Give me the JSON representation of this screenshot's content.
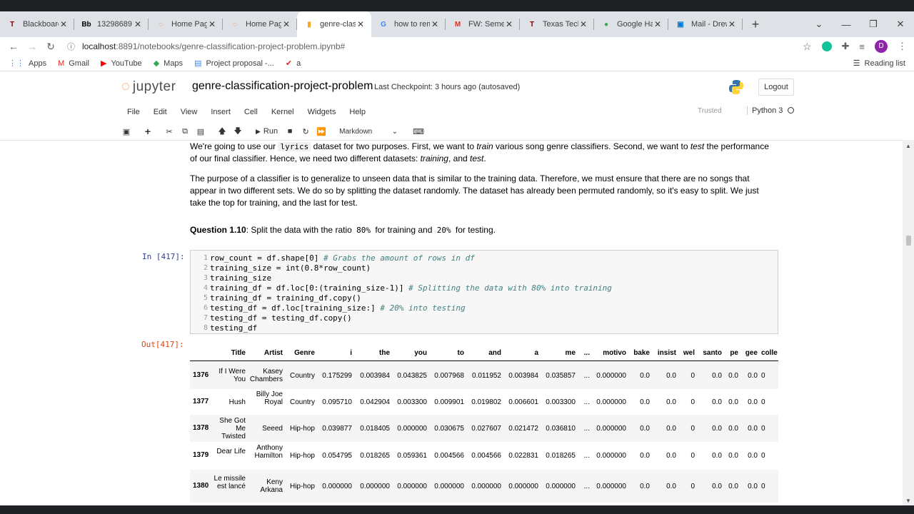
{
  "browser": {
    "tabs": [
      {
        "title": "Blackboard",
        "fav": "T",
        "color": "#8b0000"
      },
      {
        "title": "13298689",
        "fav": "Bb",
        "color": "#000000"
      },
      {
        "title": "Home Page",
        "fav": "◌",
        "color": "#f37726"
      },
      {
        "title": "Home Page",
        "fav": "◌",
        "color": "#f37726"
      },
      {
        "title": "genre-class",
        "fav": "▮",
        "color": "#f9a825"
      },
      {
        "title": "how to rem",
        "fav": "G",
        "color": "#4285f4"
      },
      {
        "title": "FW: Semest",
        "fav": "M",
        "color": "#d93025"
      },
      {
        "title": "Texas Tech",
        "fav": "T",
        "color": "#8b0000"
      },
      {
        "title": "Google Har",
        "fav": "●",
        "color": "#34a853"
      },
      {
        "title": "Mail - Drew",
        "fav": "▣",
        "color": "#0078d4"
      }
    ],
    "active_tab": 4,
    "url_host": "localhost",
    "url_rest": ":8891/notebooks/genre-classification-project-problem.ipynb#",
    "profile_letter": "D",
    "bookmarks": [
      {
        "label": "Apps",
        "icon": "apps-icon"
      },
      {
        "label": "Gmail",
        "icon": "gmail-icon"
      },
      {
        "label": "YouTube",
        "icon": "youtube-icon"
      },
      {
        "label": "Maps",
        "icon": "maps-icon"
      },
      {
        "label": "Project proposal -...",
        "icon": "docs-icon"
      },
      {
        "label": "a",
        "icon": "check-icon"
      }
    ],
    "reading_list": "Reading list"
  },
  "jupyter": {
    "logo_text": "jupyter",
    "notebook_title": "genre-classification-project-problem",
    "checkpoint": "Last Checkpoint: 3 hours ago  (autosaved)",
    "logout": "Logout",
    "menu": [
      "File",
      "Edit",
      "View",
      "Insert",
      "Cell",
      "Kernel",
      "Widgets",
      "Help"
    ],
    "trusted": "Trusted",
    "kernel": "Python 3",
    "run_label": "Run",
    "cell_type": "Markdown"
  },
  "notebook": {
    "p1_a": "We're going to use our ",
    "p1_code": "lyrics",
    "p1_b": " dataset for two purposes. First, we want to ",
    "p1_train": "train",
    "p1_c": " various song genre classifiers. Second, we want to ",
    "p1_test": "test",
    "p1_d": " the performance of our final classifier. Hence, we need two different datasets: ",
    "p1_training": "training",
    "p1_e": ", and ",
    "p1_testing": "test",
    "p1_f": ".",
    "p2": "The purpose of a classifier is to generalize to unseen data that is similar to the training data. Therefore, we must ensure that there are no songs that appear in two different sets. We do so by splitting the dataset randomly. The dataset has already been permuted randomly, so it's easy to split. We just take the top for training, and the last for test.",
    "q_label": "Question 1.10",
    "q_a": ": Split the data with the ratio ",
    "q_80": "80%",
    "q_b": " for training and ",
    "q_20": "20%",
    "q_c": " for testing.",
    "in_prompt": "In [417]:",
    "out_prompt": "Out[417]:",
    "code_lines": [
      {
        "n": "1",
        "code": "row_count = df.shape[0] ",
        "comment": "# Grabs the amount of rows in df"
      },
      {
        "n": "2",
        "code": "training_size = int(0.8*row_count)",
        "comment": ""
      },
      {
        "n": "3",
        "code": "training_size",
        "comment": ""
      },
      {
        "n": "4",
        "code": "training_df = df.loc[0:(training_size-1)] ",
        "comment": "# Splitting the data with 80% into training"
      },
      {
        "n": "5",
        "code": "training_df = training_df.copy()",
        "comment": ""
      },
      {
        "n": "6",
        "code": "testing_df = df.loc[training_size:] ",
        "comment": "# 20% into testing"
      },
      {
        "n": "7",
        "code": "testing_df = testing_df.copy()",
        "comment": ""
      },
      {
        "n": "8",
        "code": "testing_df",
        "comment": ""
      }
    ],
    "table": {
      "columns": [
        "Title",
        "Artist",
        "Genre",
        "i",
        "the",
        "you",
        "to",
        "and",
        "a",
        "me",
        "...",
        "motivo",
        "bake",
        "insist",
        "wel",
        "santo",
        "pe",
        "gee",
        "colle"
      ],
      "rows": [
        {
          "idx": "1376",
          "cells": [
            "If I Were You",
            "Kasey Chambers",
            "Country",
            "0.175299",
            "0.003984",
            "0.043825",
            "0.007968",
            "0.011952",
            "0.003984",
            "0.035857",
            "...",
            "0.000000",
            "0.0",
            "0.0",
            "0",
            "0.0",
            "0.0",
            "0.0",
            "0"
          ]
        },
        {
          "idx": "1377",
          "cells": [
            "Hush",
            "Billy Joe Royal",
            "Country",
            "0.095710",
            "0.042904",
            "0.003300",
            "0.009901",
            "0.019802",
            "0.006601",
            "0.003300",
            "...",
            "0.000000",
            "0.0",
            "0.0",
            "0",
            "0.0",
            "0.0",
            "0.0",
            "0"
          ]
        },
        {
          "idx": "1378",
          "cells": [
            "She Got Me Twisted",
            "Seeed",
            "Hip-hop",
            "0.039877",
            "0.018405",
            "0.000000",
            "0.030675",
            "0.027607",
            "0.021472",
            "0.036810",
            "...",
            "0.000000",
            "0.0",
            "0.0",
            "0",
            "0.0",
            "0.0",
            "0.0",
            "0"
          ]
        },
        {
          "idx": "1379",
          "cells": [
            "Dear Life",
            "Anthony Hamilton",
            "Hip-hop",
            "0.054795",
            "0.018265",
            "0.059361",
            "0.004566",
            "0.004566",
            "0.022831",
            "0.018265",
            "...",
            "0.000000",
            "0.0",
            "0.0",
            "0",
            "0.0",
            "0.0",
            "0.0",
            "0"
          ]
        },
        {
          "idx": "1380",
          "cells": [
            "Le missile est lancé",
            "Keny Arkana",
            "Hip-hop",
            "0.000000",
            "0.000000",
            "0.000000",
            "0.000000",
            "0.000000",
            "0.000000",
            "0.000000",
            "...",
            "0.000000",
            "0.0",
            "0.0",
            "0",
            "0.0",
            "0.0",
            "0.0",
            "0"
          ]
        }
      ]
    }
  }
}
